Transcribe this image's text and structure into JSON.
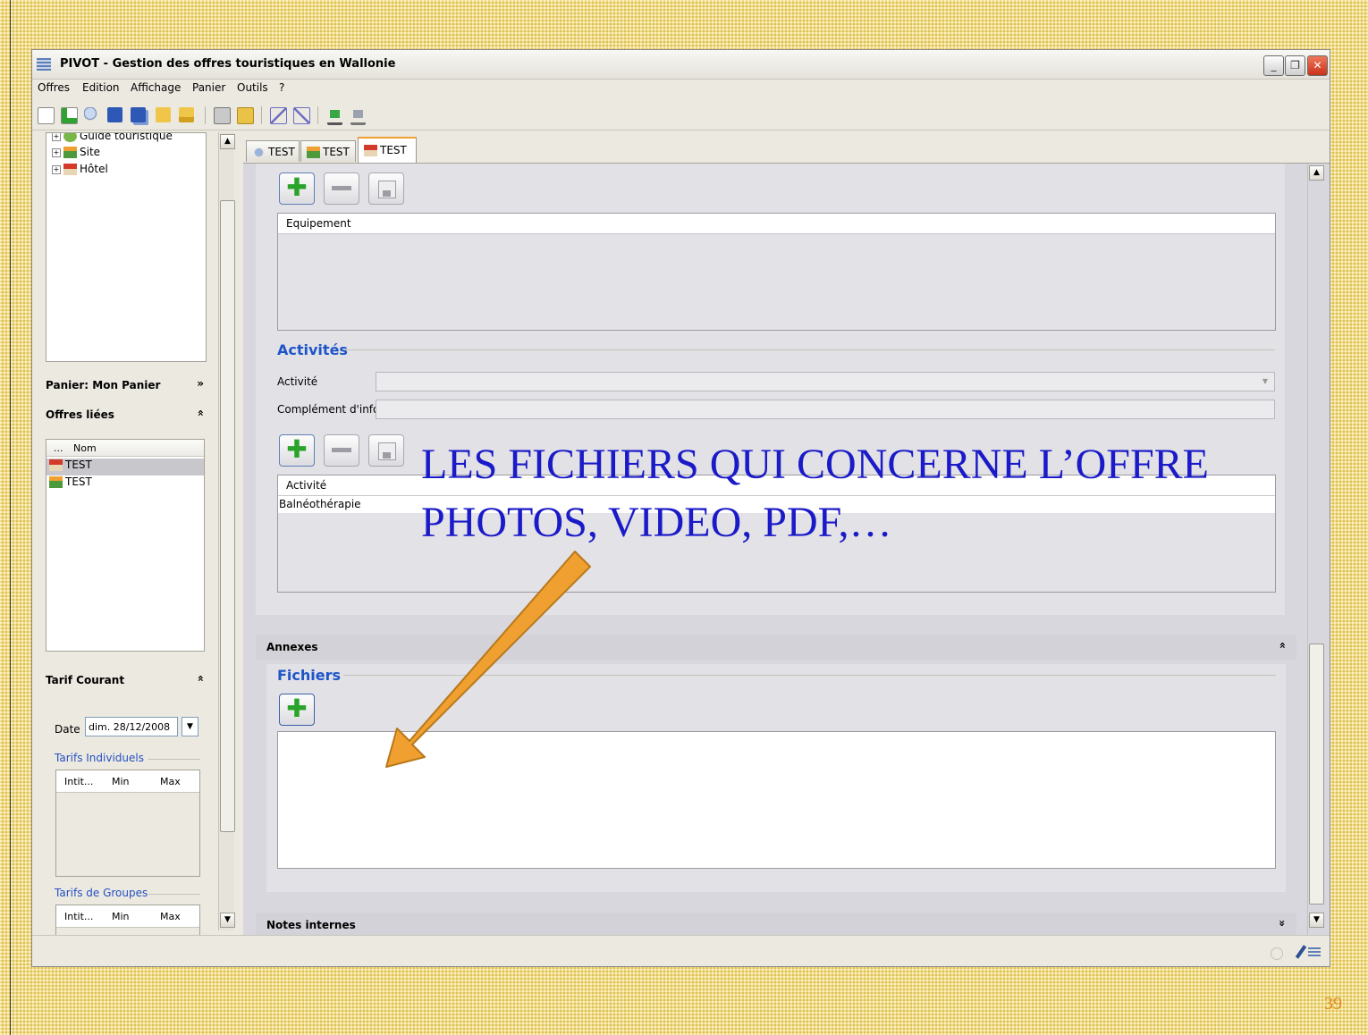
{
  "window": {
    "title": "PIVOT - Gestion des offres touristiques en Wallonie",
    "controls": [
      "_",
      "❐",
      "✕"
    ]
  },
  "menu": [
    "Offres",
    "Edition",
    "Affichage",
    "Panier",
    "Outils",
    "?"
  ],
  "tree": {
    "items": [
      "Guide touristique",
      "Site",
      "Hôtel"
    ]
  },
  "basket": {
    "label": "Panier: Mon Panier",
    "linked_label": "Offres liées",
    "column": "Nom",
    "column_prefix": "...",
    "rows": [
      "TEST",
      "TEST"
    ]
  },
  "tarif": {
    "label": "Tarif Courant",
    "date_label": "Date",
    "date_value": "dim. 28/12/2008",
    "individual_label": "Tarifs Individuels",
    "group_label": "Tarifs de Groupes",
    "columns": [
      "Intit...",
      "Min",
      "Max"
    ]
  },
  "tabs": [
    "TEST",
    "TEST",
    "TEST"
  ],
  "equipment": {
    "column": "Equipement"
  },
  "activities": {
    "legend": "Activités",
    "activity_label": "Activité",
    "complement_label": "Complément d'info",
    "column": "Activité",
    "rows": [
      "Balnéothérapie"
    ]
  },
  "annexes": {
    "header": "Annexes",
    "files_legend": "Fichiers"
  },
  "notes": {
    "header": "Notes internes"
  },
  "overlay": {
    "line1": "LES FICHIERS QUI CONCERNE L’OFFRE",
    "line2": "PHOTOS, VIDEO, PDF,…"
  },
  "slide": {
    "page_number": "39"
  },
  "colors": {
    "arrow": "#f0a030",
    "overlay_text": "#1a1ac8",
    "legend_blue": "#1e55c8"
  }
}
